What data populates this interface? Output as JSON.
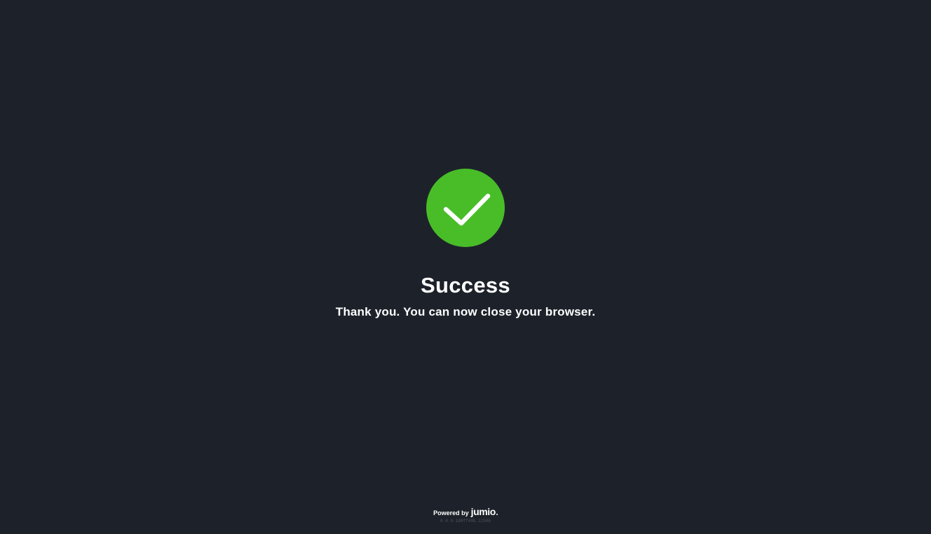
{
  "colors": {
    "background": "#1d222a",
    "success": "#48bd28",
    "text": "#ffffff",
    "version_text": "#4b525c"
  },
  "status": {
    "icon": "checkmark-circle-icon",
    "title": "Success",
    "message": "Thank you. You can now close your browser."
  },
  "footer": {
    "powered_by": "Powered by",
    "brand": "jumio",
    "version": "0.4.0-1d0ff49b.12506"
  }
}
